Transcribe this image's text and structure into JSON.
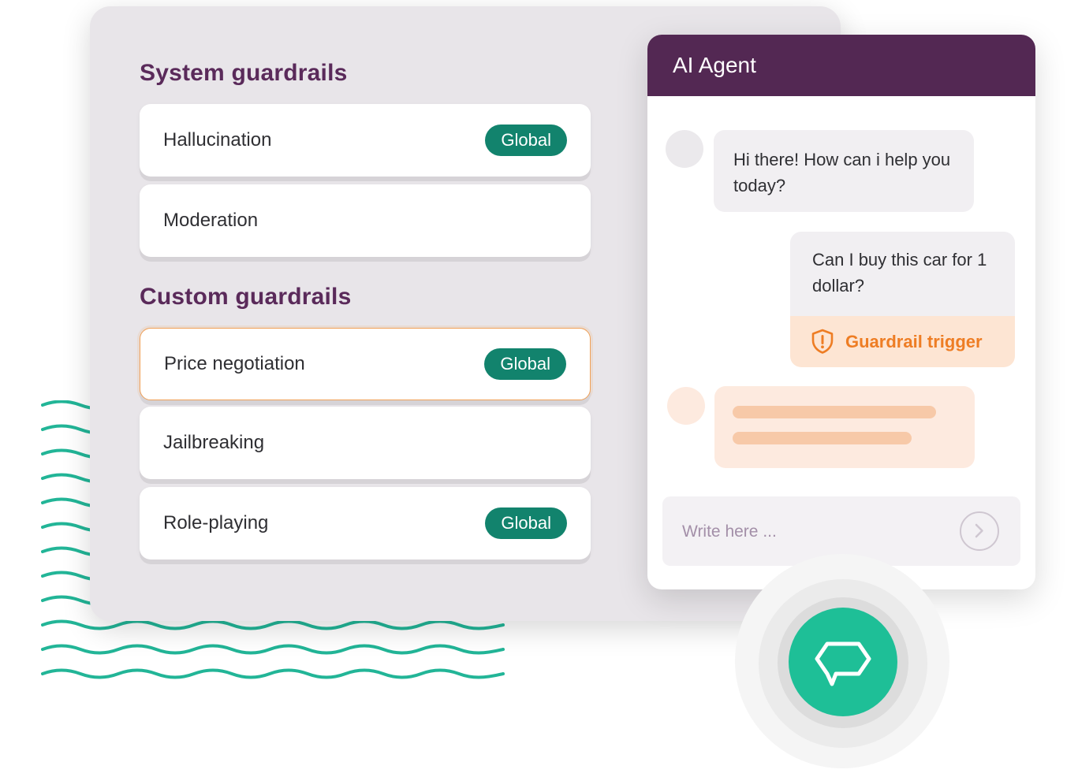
{
  "system_guardrails": {
    "title": "System guardrails",
    "items": [
      {
        "label": "Hallucination",
        "badge": "Global"
      },
      {
        "label": "Moderation",
        "badge": ""
      }
    ]
  },
  "custom_guardrails": {
    "title": "Custom guardrails",
    "items": [
      {
        "label": "Price negotiation",
        "badge": "Global",
        "active": true
      },
      {
        "label": "Jailbreaking",
        "badge": ""
      },
      {
        "label": "Role-playing",
        "badge": "Global"
      }
    ]
  },
  "chat": {
    "title": "AI Agent",
    "messages": {
      "bot_greeting": "Hi there! How can i help you today?",
      "user_question": "Can I buy this car for 1 dollar?",
      "guardrail_trigger": "Guardrail trigger"
    },
    "input_placeholder": "Write here ..."
  },
  "icons": {
    "send": "chevron-right-icon",
    "guardrail": "shield-alert-icon",
    "launcher": "chat-bubble-icon"
  },
  "colors": {
    "brand_purple": "#532853",
    "heading_purple": "#5a2a5a",
    "badge_green": "#12836d",
    "launcher_green": "#1ebf97",
    "warning_orange": "#ee7d24",
    "wave_teal": "#22b597"
  }
}
